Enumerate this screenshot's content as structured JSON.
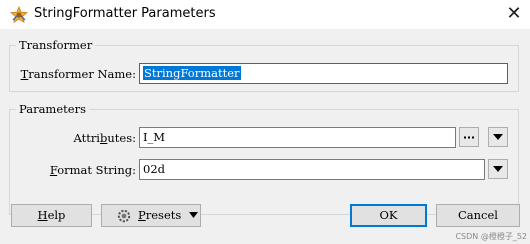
{
  "window": {
    "title": "StringFormatter Parameters",
    "icon": "fme-transformer-icon",
    "close_label": "✕"
  },
  "transformer_group": {
    "legend": "Transformer",
    "name_label": "Transformer Name:",
    "name_value": "StringFormatter"
  },
  "parameters_group": {
    "legend": "Parameters",
    "attributes_label": "Attributes:",
    "attributes_value": "I_M",
    "format_label": "Format String:",
    "format_value": "02d"
  },
  "buttons": {
    "help": "Help",
    "presets": "Presets",
    "ok": "OK",
    "cancel": "Cancel"
  },
  "watermark": "CSDN @橙橙子_52",
  "colors": {
    "selection": "#0078d7",
    "background": "#f0f0f0"
  }
}
